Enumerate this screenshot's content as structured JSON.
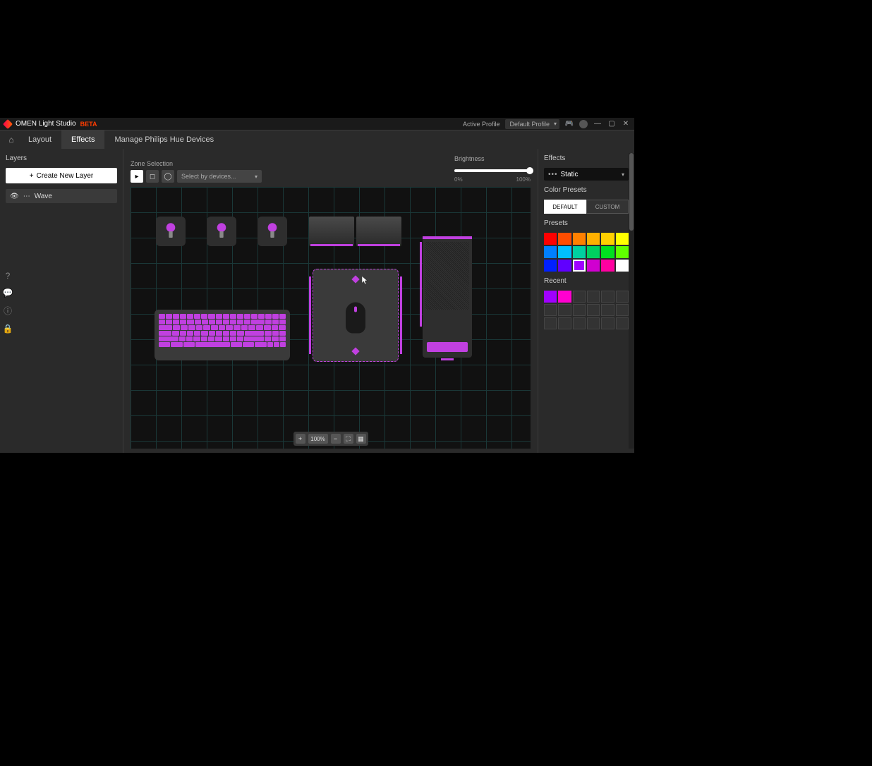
{
  "titlebar": {
    "app_name": "OMEN Light Studio",
    "beta": "BETA",
    "active_profile_label": "Active Profile",
    "active_profile_value": "Default Profile"
  },
  "tabs": {
    "layout": "Layout",
    "effects": "Effects",
    "hue": "Manage Philips Hue Devices"
  },
  "layers": {
    "heading": "Layers",
    "create_button": "Create New Layer",
    "items": [
      {
        "name": "Wave"
      }
    ]
  },
  "toolbar": {
    "zone_selection_label": "Zone Selection",
    "select_placeholder": "Select by devices...",
    "brightness_label": "Brightness",
    "brightness_min": "0%",
    "brightness_max": "100%",
    "zoom_value": "100%"
  },
  "effects": {
    "heading": "Effects",
    "current": "Static",
    "color_presets_label": "Color Presets",
    "tab_default": "DEFAULT",
    "tab_custom": "CUSTOM",
    "presets_label": "Presets",
    "presets": [
      "#ff0000",
      "#ff4d00",
      "#ff8000",
      "#ffb000",
      "#ffd000",
      "#ffff00",
      "#0080ff",
      "#00c0ff",
      "#00d0a0",
      "#00d060",
      "#00e020",
      "#60ff00",
      "#0020ff",
      "#6000ff",
      "#a000ff",
      "#d000d0",
      "#ff00a0",
      "#ffffff"
    ],
    "selected_preset_index": 14,
    "recent_label": "Recent",
    "recent": [
      "#a000ff",
      "#ff00d0",
      "",
      "",
      "",
      "",
      "",
      "",
      "",
      "",
      "",
      "",
      "",
      "",
      "",
      "",
      "",
      ""
    ]
  },
  "accent": "#c040e0"
}
